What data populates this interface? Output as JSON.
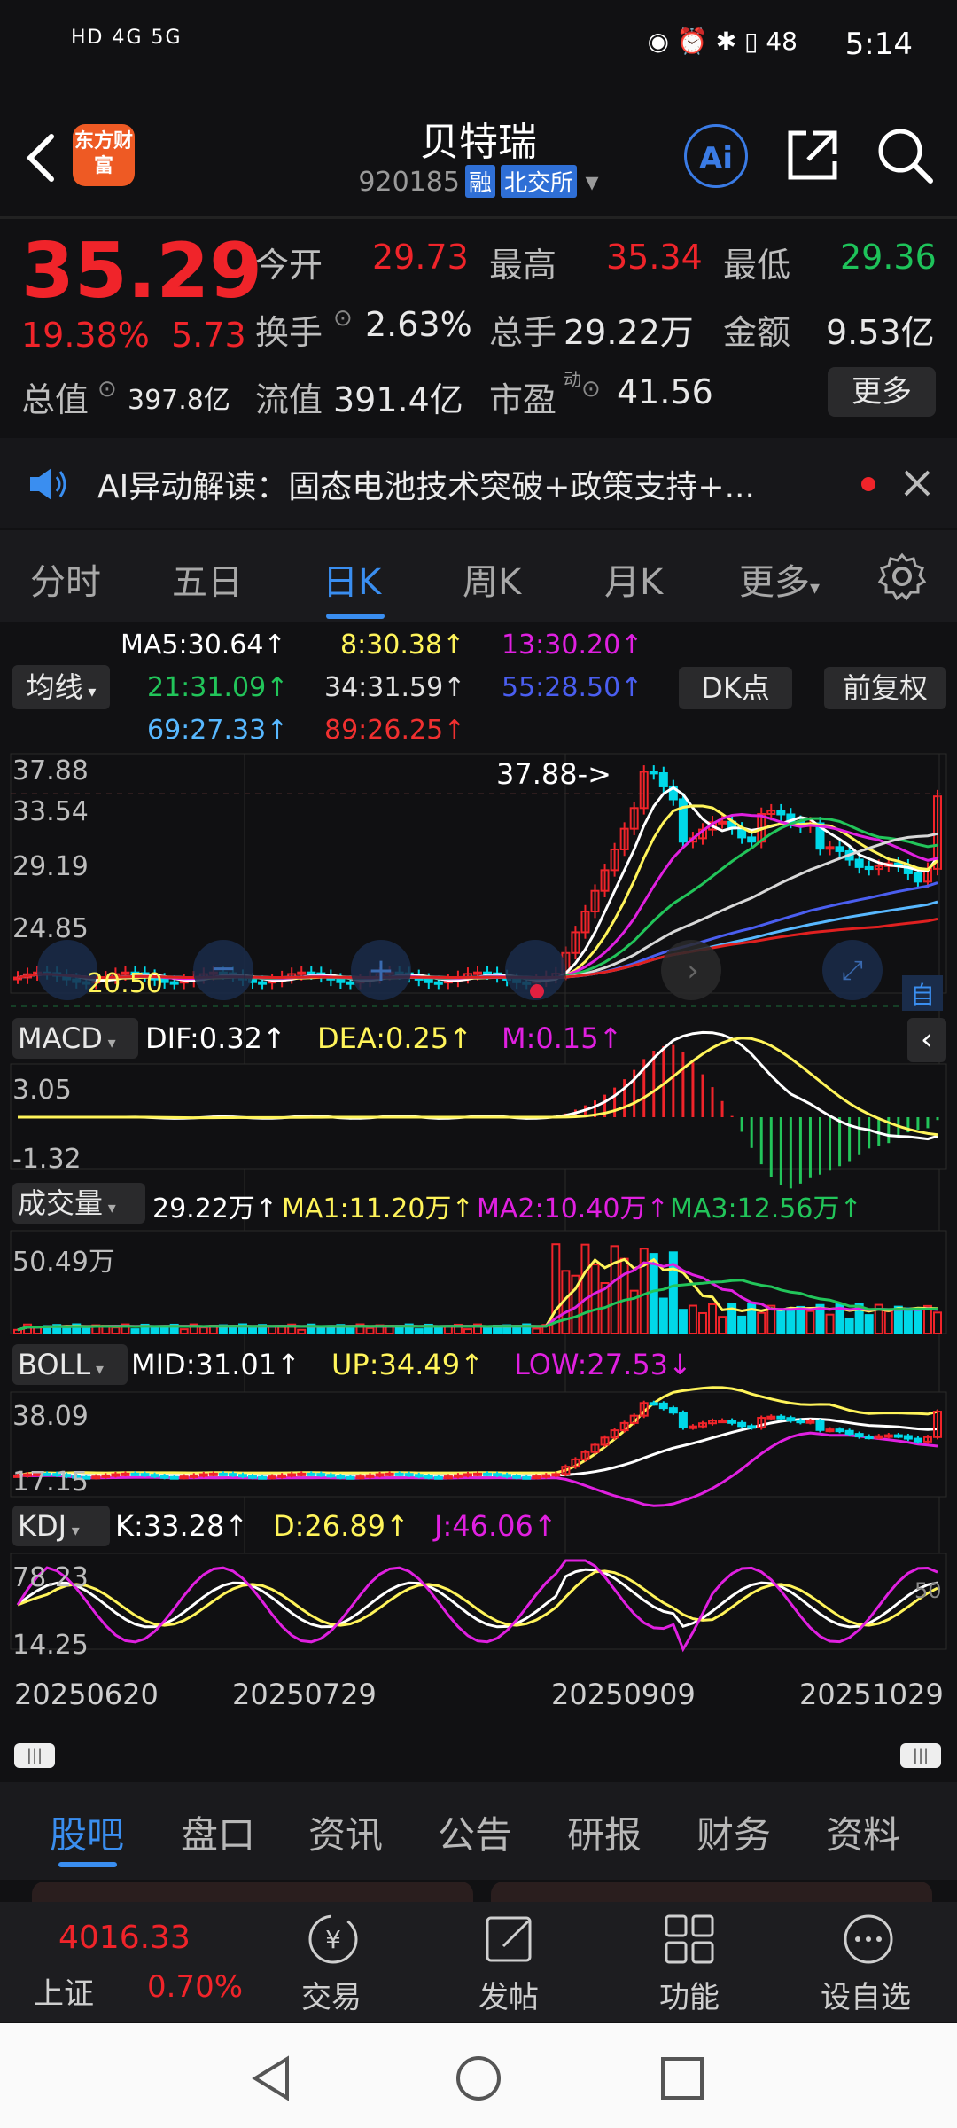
{
  "status_bar": {
    "left_text": "HD 4G 5G",
    "battery": "48",
    "time": "5:14"
  },
  "header": {
    "logo_text": "东方财富",
    "title": "贝特瑞",
    "code": "920185",
    "tag1": "融",
    "tag2": "北交所",
    "ai_label": "Ai"
  },
  "quote": {
    "price": "35.29",
    "change_pct": "19.38%",
    "change_abs": "5.73",
    "open_label": "今开",
    "open": "29.73",
    "high_label": "最高",
    "high": "35.34",
    "low_label": "最低",
    "low": "29.36",
    "turnover_label": "换手",
    "turnover": "2.63%",
    "volume_label": "总手",
    "volume": "29.22万",
    "amount_label": "金额",
    "amount": "9.53亿",
    "mktcap_label": "总值",
    "mktcap": "397.8亿",
    "float_label": "流值",
    "float": "391.4亿",
    "pe_label": "市盈",
    "pe_sup": "动",
    "pe": "41.56",
    "more_label": "更多"
  },
  "ai_bar": {
    "text": "AI异动解读：固态电池技术突破+政策支持+..."
  },
  "chart_tabs": [
    "分时",
    "五日",
    "日K",
    "周K",
    "月K",
    "更多"
  ],
  "active_chart_tab": 2,
  "ma_legend": {
    "toggle": "均线",
    "row1": [
      "MA5:30.64↑",
      "8:30.38↑",
      "13:30.20↑"
    ],
    "row2": [
      "21:31.09↑",
      "34:31.59↑",
      "55:28.50↑"
    ],
    "row3": [
      "69:27.33↑",
      "89:26.25↑"
    ],
    "dk_label": "DK点",
    "adjust_label": "前复权"
  },
  "kline": {
    "y_labels": [
      "37.88",
      "33.54",
      "29.19",
      "24.85",
      "20.50"
    ],
    "max_marker": "37.88->",
    "low_marker": "20.50",
    "self_label": "自"
  },
  "macd": {
    "name": "MACD",
    "dif": "DIF:0.32↑",
    "dea": "DEA:0.25↑",
    "m": "M:0.15↑",
    "y_top": "3.05",
    "y_bottom": "-1.32"
  },
  "volume": {
    "name": "成交量",
    "v": "29.22万↑",
    "ma1": "MA1:11.20万↑",
    "ma2": "MA2:10.40万↑",
    "ma3": "MA3:12.56万↑",
    "y_top": "50.49万"
  },
  "boll": {
    "name": "BOLL",
    "mid": "MID:31.01↑",
    "up": "UP:34.49↑",
    "low": "LOW:27.53↓",
    "y_top": "38.09",
    "y_bottom": "17.15"
  },
  "kdj": {
    "name": "KDJ",
    "k": "K:33.28↑",
    "d": "D:26.89↑",
    "j": "J:46.06↑",
    "y_top": "78.23",
    "y_bottom": "14.25",
    "right_50": "50"
  },
  "dates": [
    "20250620",
    "20250729",
    "20250909",
    "20251029"
  ],
  "bottom_tabs": [
    "股吧",
    "盘口",
    "资讯",
    "公告",
    "研报",
    "财务",
    "资料"
  ],
  "active_bottom_tab": 0,
  "index": {
    "value": "4016.33",
    "name": "上证",
    "change": "0.70%"
  },
  "bottom_bar": [
    "交易",
    "发帖",
    "功能",
    "设自选"
  ],
  "colors": {
    "up": "#f0242a",
    "down": "#00d8e8",
    "accent": "#3a8ef0",
    "ma5": "#ffffff",
    "ma8": "#fff45a",
    "ma13": "#e020e0",
    "ma21": "#22c55a",
    "ma34": "#d8d8d8",
    "ma55": "#4a5ef0",
    "ma69": "#58b8ff",
    "ma89": "#e02020"
  }
}
